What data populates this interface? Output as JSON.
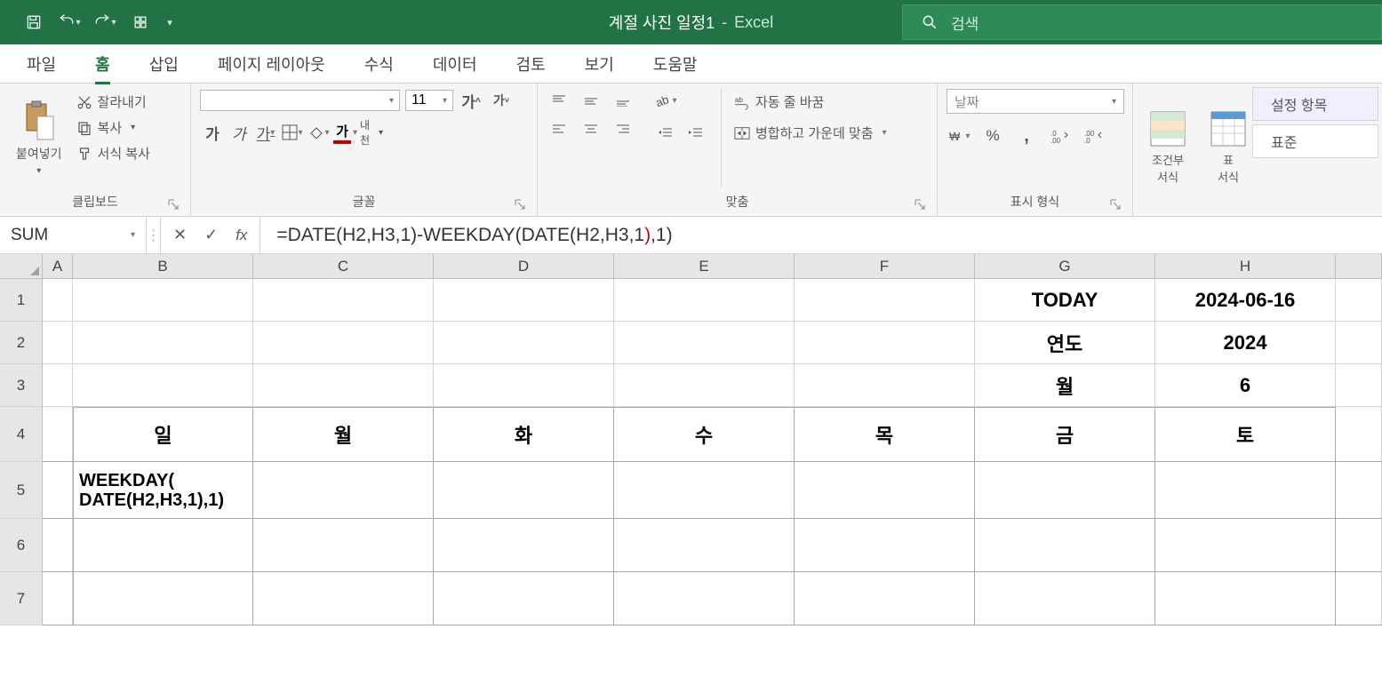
{
  "app": {
    "doc_title": "계절 사진 일정1",
    "separator": "-",
    "app_name": "Excel",
    "search_placeholder": "검색"
  },
  "qat": {
    "save": "save-icon",
    "undo": "undo-icon",
    "redo": "redo-icon",
    "touch": "touch-mode-icon",
    "customize": "customize-icon"
  },
  "tabs": [
    "파일",
    "홈",
    "삽입",
    "페이지 레이아웃",
    "수식",
    "데이터",
    "검토",
    "보기",
    "도움말"
  ],
  "active_tab_index": 1,
  "ribbon": {
    "clipboard": {
      "label": "클립보드",
      "paste": "붙여넣기",
      "cut": "잘라내기",
      "copy": "복사",
      "format_painter": "서식 복사"
    },
    "font": {
      "label": "글꼴",
      "font_name": "",
      "font_size": "11",
      "bold": "가",
      "italic": "가",
      "underline": "가"
    },
    "alignment": {
      "label": "맞춤",
      "wrap": "자동 줄 바꿈",
      "merge": "병합하고 가운데 맞춤"
    },
    "number": {
      "label": "표시 형식",
      "format": "날짜"
    },
    "styles": {
      "cond": "조건부\n서식",
      "table": "표\n서식"
    },
    "cell_styles": {
      "heading": "설정 항목",
      "normal": "표준"
    }
  },
  "formula_bar": {
    "name_box": "SUM",
    "formula_prefix": "=DATE(H2,H3,1)-WEEKDAY(DATE(H2,H3,1",
    "formula_paren": ")",
    "formula_suffix": ",1)"
  },
  "columns": [
    "A",
    "B",
    "C",
    "D",
    "E",
    "F",
    "G",
    "H"
  ],
  "rows": [
    "1",
    "2",
    "3",
    "4",
    "5",
    "6",
    "7"
  ],
  "cells": {
    "G1": "TODAY",
    "H1": "2024-06-16",
    "G2": "연도",
    "H2": "2024",
    "G3": "월",
    "H3": "6",
    "B4": "일",
    "C4": "월",
    "D4": "화",
    "E4": "수",
    "F4": "목",
    "G4": "금",
    "H4": "토",
    "B5": "WEEKDAY(\nDATE(H2,H3,1),1)"
  }
}
